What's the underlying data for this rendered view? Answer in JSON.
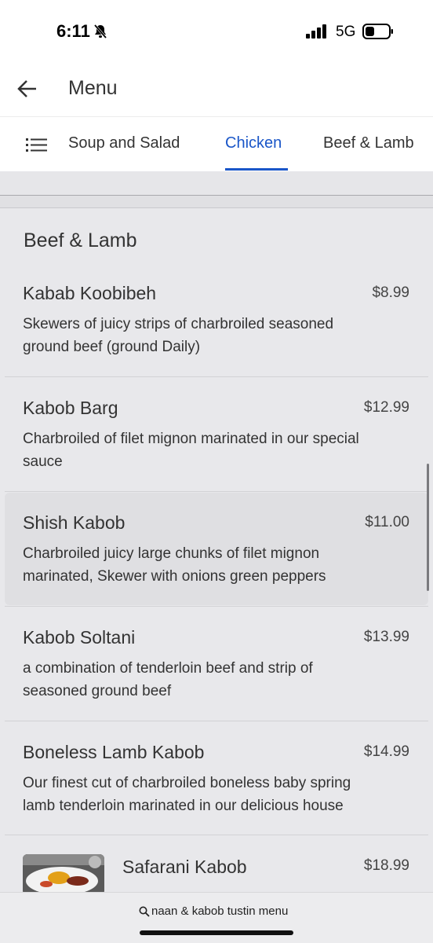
{
  "status_bar": {
    "time": "6:11",
    "network": "5G"
  },
  "app_bar": {
    "title": "Menu"
  },
  "tabs": [
    {
      "label": "Soup and Salad",
      "active": false
    },
    {
      "label": "Chicken",
      "active": true
    },
    {
      "label": "Beef & Lamb",
      "active": false
    }
  ],
  "section": {
    "title": "Beef & Lamb"
  },
  "items": [
    {
      "name": "Kabab Koobibeh",
      "price": "$8.99",
      "desc_line1": "Skewers of juicy strips of charbroiled seasoned",
      "desc_line2": "ground beef (ground Daily)"
    },
    {
      "name": "Kabob Barg",
      "price": "$12.99",
      "desc_line1": "Charbroiled of filet mignon marinated in our special",
      "desc_line2": "sauce"
    },
    {
      "name": "Shish Kabob",
      "price": "$11.00",
      "desc_line1": "Charbroiled juicy large chunks of filet mignon",
      "desc_line2": "marinated, Skewer with onions green peppers"
    },
    {
      "name": "Kabob Soltani",
      "price": "$13.99",
      "desc_line1": "a combination of tenderloin beef and strip of",
      "desc_line2": "seasoned ground beef"
    },
    {
      "name": "Boneless Lamb Kabob",
      "price": "$14.99",
      "desc_line1": "Our finest cut of charbroiled boneless baby spring",
      "desc_line2": "lamb tenderloin marinated in our delicious house"
    },
    {
      "name": "Safarani Kabob",
      "price": "$18.99"
    }
  ],
  "browser": {
    "url_text": "naan & kabob tustin menu"
  },
  "colors": {
    "accent": "#1a56c8",
    "background": "#e8e8eb"
  },
  "icons": [
    "bell-off-icon",
    "signal-icon",
    "battery-icon",
    "back-arrow-icon",
    "list-icon",
    "search-icon"
  ]
}
